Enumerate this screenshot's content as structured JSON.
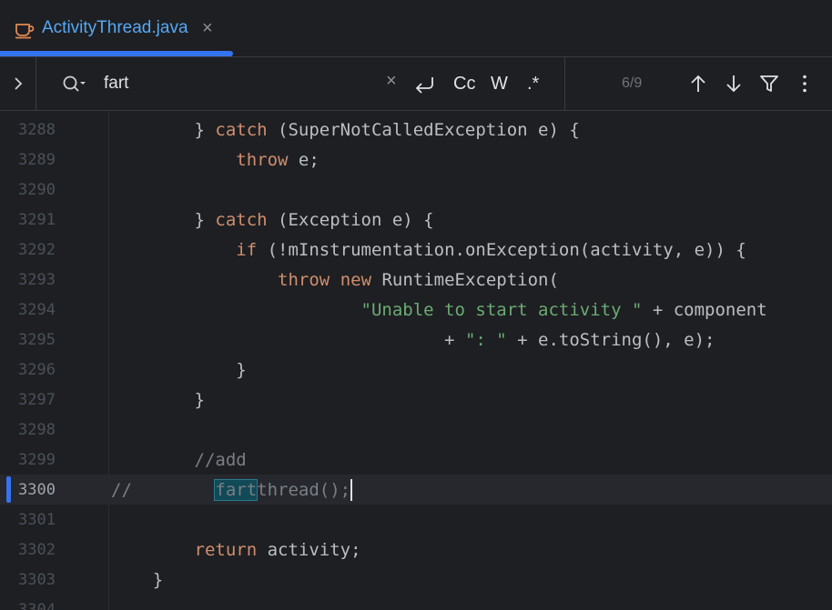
{
  "tab": {
    "label": "ActivityThread.java",
    "icon": "coffee-cup-icon",
    "accent": "#56a8f5",
    "underline_color": "#3574f0"
  },
  "search": {
    "query": "fart",
    "options": {
      "case_label": "Cc",
      "words_label": "W",
      "regex_label": ".*"
    },
    "match_count": "6/9"
  },
  "editor": {
    "lines": [
      {
        "num": "3288"
      },
      {
        "num": "3289"
      },
      {
        "num": "3290"
      },
      {
        "num": "3291"
      },
      {
        "num": "3292"
      },
      {
        "num": "3293"
      },
      {
        "num": "3294"
      },
      {
        "num": "3295"
      },
      {
        "num": "3296"
      },
      {
        "num": "3297"
      },
      {
        "num": "3298"
      },
      {
        "num": "3299"
      },
      {
        "num": "3300"
      },
      {
        "num": "3301"
      },
      {
        "num": "3302"
      },
      {
        "num": "3303"
      },
      {
        "num": "3304"
      }
    ],
    "tokens": {
      "l3288_a": "        } ",
      "l3288_kw": "catch",
      "l3288_b": " (SuperNotCalledException e) {",
      "l3289_a": "            ",
      "l3289_kw": "throw",
      "l3289_b": " e;",
      "l3291_a": "        } ",
      "l3291_kw": "catch",
      "l3291_b": " (Exception e) {",
      "l3292_a": "            ",
      "l3292_kw": "if",
      "l3292_b": " (!mInstrumentation.onException(activity, e)) {",
      "l3293_a": "                ",
      "l3293_kw1": "throw",
      "l3293_sp": " ",
      "l3293_kw2": "new",
      "l3293_b": " RuntimeException(",
      "l3294_a": "                        ",
      "l3294_str": "\"Unable to start activity \"",
      "l3294_b": " + component",
      "l3295_a": "                                + ",
      "l3295_str": "\": \"",
      "l3295_b": " + e.toString(), e);",
      "l3296_a": "            }",
      "l3297_a": "        }",
      "l3299_a": "        ",
      "l3299_cmt": "//add",
      "l3300_cmt": "//",
      "l3300_sp": "        ",
      "l3300_hl": "fart",
      "l3300_rest": "thread();",
      "l3302_a": "        ",
      "l3302_kw": "return",
      "l3302_b": " activity;",
      "l3303_a": "    }"
    },
    "colors": {
      "keyword": "#cf8e6d",
      "string": "#6aab73",
      "comment": "#7a7e85",
      "match_highlight": "#114957"
    }
  }
}
